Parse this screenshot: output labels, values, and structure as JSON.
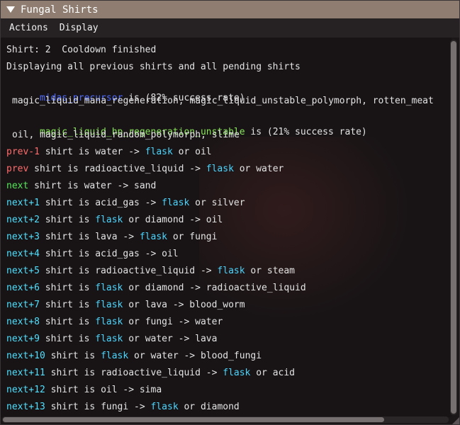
{
  "window": {
    "title": "Fungal Shirts"
  },
  "menu": {
    "actions": "Actions",
    "display": "Display"
  },
  "status": {
    "line1": "Shirt: 2  Cooldown finished",
    "line2": "Displaying all previous shirts and all pending shirts"
  },
  "groups": [
    {
      "name": "midas_precursor",
      "rate": " is (82% success rate)",
      "materials": "magic_liquid_mana_regeneration, magic_liquid_unstable_polymorph, rotten_meat"
    },
    {
      "name": "magic_liquid_hp_regeneration_unstable",
      "rate": " is (21% success rate)",
      "materials": "oil, magic_liquid_random_polymorph, slime"
    }
  ],
  "shifts": [
    {
      "label": "prev-1",
      "pre": " shirt is water -> ",
      "flask": "flask",
      "post": " or oil"
    },
    {
      "label": "prev",
      "pre": " shirt is radioactive_liquid -> ",
      "flask": "flask",
      "post": " or water"
    },
    {
      "label": "next",
      "pre": " shirt is water -> sand",
      "flask": "",
      "post": ""
    },
    {
      "label": "next+1",
      "pre": " shirt is acid_gas -> ",
      "flask": "flask",
      "post": " or silver"
    },
    {
      "label": "next+2",
      "pre": " shirt is ",
      "flask": "flask",
      "post": " or diamond -> oil"
    },
    {
      "label": "next+3",
      "pre": " shirt is lava -> ",
      "flask": "flask",
      "post": " or fungi"
    },
    {
      "label": "next+4",
      "pre": " shirt is acid_gas -> oil",
      "flask": "",
      "post": ""
    },
    {
      "label": "next+5",
      "pre": " shirt is radioactive_liquid -> ",
      "flask": "flask",
      "post": " or steam"
    },
    {
      "label": "next+6",
      "pre": " shirt is ",
      "flask": "flask",
      "post": " or diamond -> radioactive_liquid"
    },
    {
      "label": "next+7",
      "pre": " shirt is ",
      "flask": "flask",
      "post": " or lava -> blood_worm"
    },
    {
      "label": "next+8",
      "pre": " shirt is ",
      "flask": "flask",
      "post": " or fungi -> water"
    },
    {
      "label": "next+9",
      "pre": " shirt is ",
      "flask": "flask",
      "post": " or water -> lava"
    },
    {
      "label": "next+10",
      "pre": " shirt is ",
      "flask": "flask",
      "post": " or water -> blood_fungi"
    },
    {
      "label": "next+11",
      "pre": " shirt is radioactive_liquid -> ",
      "flask": "flask",
      "post": " or acid"
    },
    {
      "label": "next+12",
      "pre": " shirt is oil -> sima",
      "flask": "",
      "post": ""
    },
    {
      "label": "next+13",
      "pre": " shirt is fungi -> ",
      "flask": "flask",
      "post": " or diamond"
    }
  ],
  "icons": {
    "collapse": "collapse-triangle-icon"
  }
}
